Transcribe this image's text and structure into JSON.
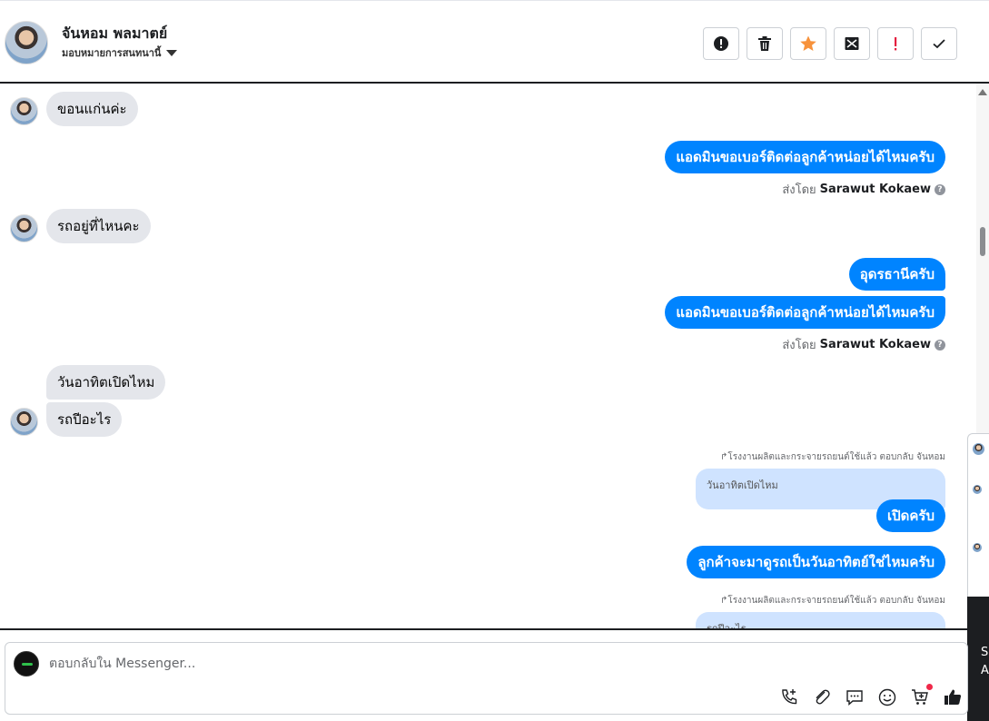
{
  "header": {
    "contact_name": "จันหอม พลมาตย์",
    "assign_label": "มอบหมายการสนทนานี้"
  },
  "toolbar": {
    "buttons": [
      {
        "name": "report-spam-button",
        "icon": "alert-circle-icon"
      },
      {
        "name": "delete-button",
        "icon": "trash-icon"
      },
      {
        "name": "star-button",
        "icon": "star-icon",
        "color": "#f7923b"
      },
      {
        "name": "mark-unread-button",
        "icon": "envelope-x-icon"
      },
      {
        "name": "mark-important-button",
        "icon": "exclamation-icon",
        "color": "#e41e3f"
      },
      {
        "name": "mark-done-button",
        "icon": "check-icon"
      }
    ]
  },
  "messages": [
    {
      "dir": "in",
      "text": "ขอนแก่นค่ะ"
    },
    {
      "dir": "out",
      "text": "แอดมินขอเบอร์ติดต่อลูกค้าหน่อยได้ไหมครับ"
    },
    {
      "dir": "in",
      "text": "รถอยู่ที่ไหนคะ"
    },
    {
      "dir": "out",
      "text": "อุดรธานีครับ"
    },
    {
      "dir": "out",
      "text": "แอดมินขอเบอร์ติดต่อลูกค้าหน่อยได้ไหมครับ"
    },
    {
      "dir": "in",
      "text": "วันอาทิตเปิดไหม"
    },
    {
      "dir": "in",
      "text": "รถปีอะไร"
    },
    {
      "dir": "out",
      "text": "เปิดครับ"
    },
    {
      "dir": "out",
      "text": "ลูกค้าจะมาดูรถเป็นวันอาทิตย์ใช่ไหมครับ"
    }
  ],
  "sent_by": {
    "prefix": "ส่งโดย",
    "agent": "Sarawut Kokaew"
  },
  "replies": [
    {
      "meta": "โรงงานผลิตและกระจายรถยนต์ใช้แล้ว ตอบกลับ จันหอม",
      "quoted": "วันอาทิตเปิดไหม"
    },
    {
      "meta": "โรงงานผลิตและกระจายรถยนต์ใช้แล้ว ตอบกลับ จันหอม",
      "quoted": "รถปีอะไร"
    }
  ],
  "composer": {
    "placeholder": "ตอบกลับใน Messenger..."
  },
  "side_panel": {
    "letters": [
      "S",
      "A"
    ]
  },
  "colors": {
    "outgoing_bubble": "#0084ff",
    "incoming_bubble": "#e4e6eb",
    "quoted_bubble": "#cfe3ff"
  }
}
